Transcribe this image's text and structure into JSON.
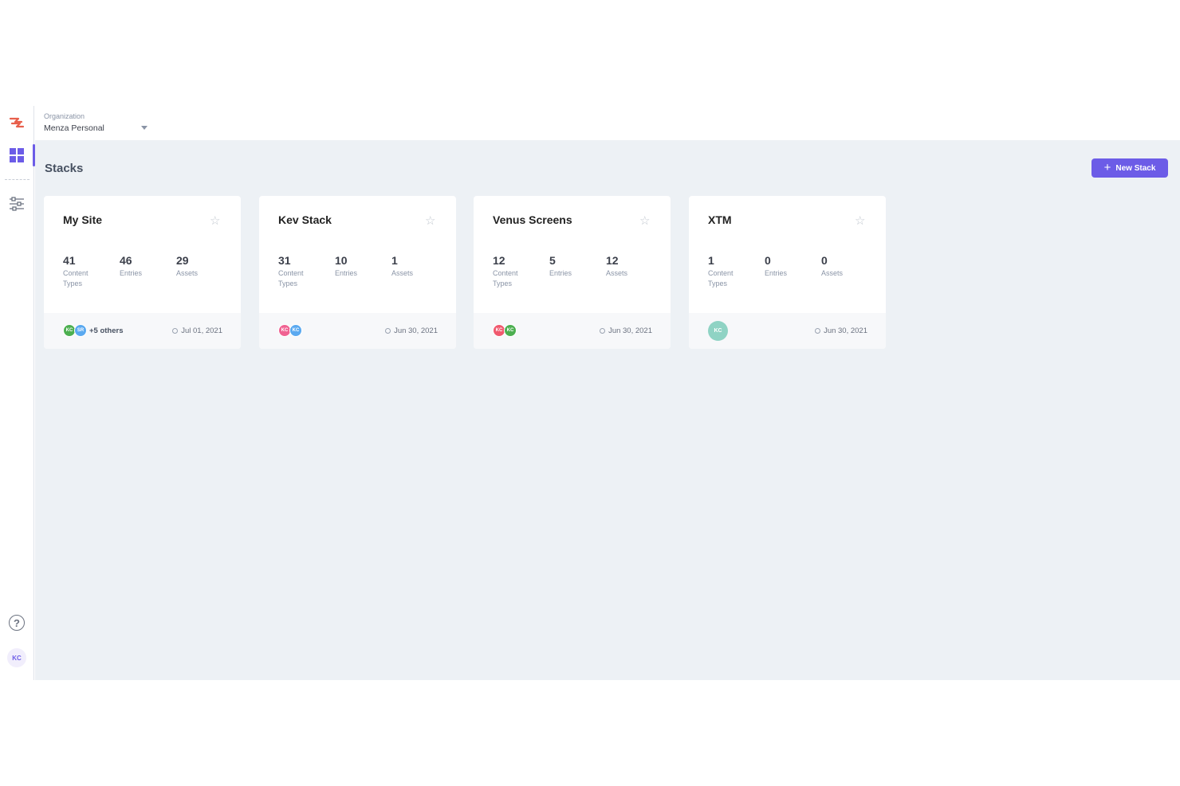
{
  "organization": {
    "label": "Organization",
    "name": "Menza Personal"
  },
  "sidebar": {
    "help_glyph": "?",
    "user_initials": "KC",
    "colors": {
      "logo": "#e8604c",
      "active": "#6c5ce7"
    }
  },
  "page": {
    "title": "Stacks",
    "new_stack_label": "New Stack",
    "new_stack_icon": "+"
  },
  "stacks": [
    {
      "name": "My Site",
      "stats": [
        {
          "value": "41",
          "label": "Content Types"
        },
        {
          "value": "46",
          "label": "Entries"
        },
        {
          "value": "29",
          "label": "Assets"
        }
      ],
      "members": [
        {
          "initials": "KC",
          "color": "#4caf50"
        },
        {
          "initials": "SR",
          "color": "#5aa9f0"
        }
      ],
      "others": "+5 others",
      "date": "Jul 01, 2021"
    },
    {
      "name": "Kev Stack",
      "stats": [
        {
          "value": "31",
          "label": "Content Types"
        },
        {
          "value": "10",
          "label": "Entries"
        },
        {
          "value": "1",
          "label": "Assets"
        }
      ],
      "members": [
        {
          "initials": "KC",
          "color": "#f06292"
        },
        {
          "initials": "KC",
          "color": "#5aa9f0"
        }
      ],
      "date": "Jun 30, 2021"
    },
    {
      "name": "Venus Screens",
      "stats": [
        {
          "value": "12",
          "label": "Content Types"
        },
        {
          "value": "5",
          "label": "Entries"
        },
        {
          "value": "12",
          "label": "Assets"
        }
      ],
      "members": [
        {
          "initials": "KC",
          "color": "#f0596e"
        },
        {
          "initials": "KC",
          "color": "#4caf50"
        }
      ],
      "date": "Jun 30, 2021"
    },
    {
      "name": "XTM",
      "stats": [
        {
          "value": "1",
          "label": "Content Types"
        },
        {
          "value": "0",
          "label": "Entries"
        },
        {
          "value": "0",
          "label": "Assets"
        }
      ],
      "members": [
        {
          "initials": "KC",
          "color": "#8fd3c4"
        }
      ],
      "date": "Jun 30, 2021"
    }
  ]
}
